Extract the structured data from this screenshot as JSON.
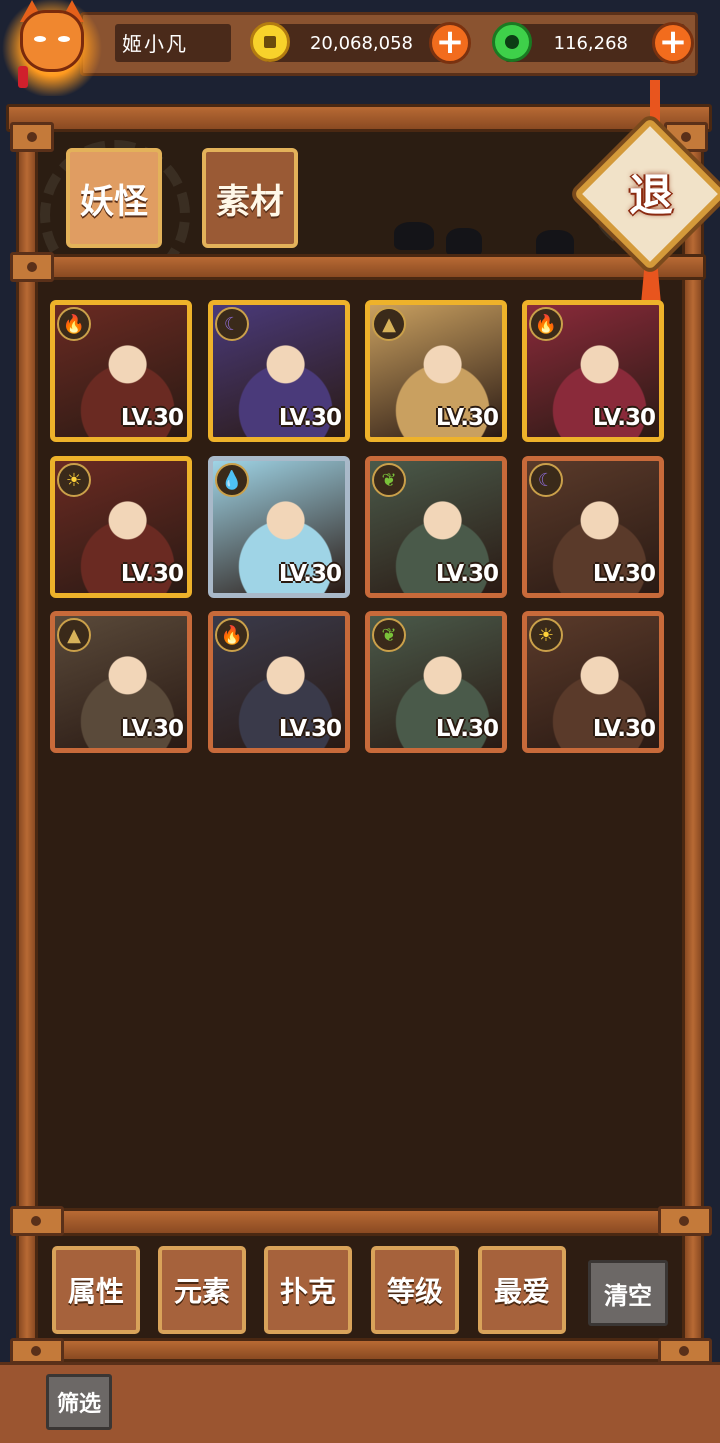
{
  "player": {
    "name": "姬小凡"
  },
  "currency": {
    "gold_amount": "20,068,058",
    "jade_amount": "116,268",
    "gold_plus_icon": "plus-icon",
    "jade_plus_icon": "plus-icon"
  },
  "tabs": [
    {
      "label": "妖怪",
      "active": true
    },
    {
      "label": "素材",
      "active": false
    }
  ],
  "exit": {
    "label": "退"
  },
  "cards": [
    {
      "element": "fire",
      "frame": "gold",
      "level": "LV.30"
    },
    {
      "element": "moon",
      "frame": "gold",
      "level": "LV.30"
    },
    {
      "element": "earth",
      "frame": "gold",
      "level": "LV.30"
    },
    {
      "element": "fire",
      "frame": "gold",
      "level": "LV.30"
    },
    {
      "element": "sun",
      "frame": "gold",
      "level": "LV.30"
    },
    {
      "element": "water",
      "frame": "silver",
      "level": "LV.30"
    },
    {
      "element": "leaf",
      "frame": "bronze",
      "level": "LV.30"
    },
    {
      "element": "moon",
      "frame": "bronze",
      "level": "LV.30"
    },
    {
      "element": "earth",
      "frame": "bronze",
      "level": "LV.30"
    },
    {
      "element": "fire",
      "frame": "bronze",
      "level": "LV.30"
    },
    {
      "element": "leaf",
      "frame": "bronze",
      "level": "LV.30"
    },
    {
      "element": "sun",
      "frame": "bronze",
      "level": "LV.30"
    }
  ],
  "filters": [
    {
      "label": "属性"
    },
    {
      "label": "元素"
    },
    {
      "label": "扑克"
    },
    {
      "label": "等级"
    },
    {
      "label": "最爱"
    }
  ],
  "clear_label": "清空",
  "screen_label": "筛选",
  "colors": {
    "wood": "#8a5330",
    "panel": "#2e1d12",
    "gold_frame": "#eeb22a",
    "silver_frame": "#a9b9c9",
    "bronze_frame": "#c86a3a",
    "accent_orange": "#f26c1d"
  }
}
